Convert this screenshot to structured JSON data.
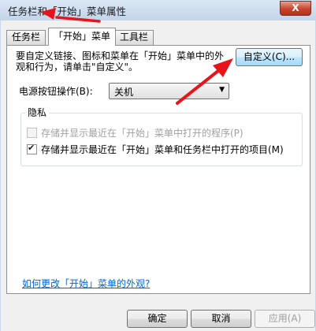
{
  "window": {
    "title": "任务栏和「开始」菜单属性",
    "close_label": "X"
  },
  "tabs": [
    {
      "label": "任务栏",
      "active": false
    },
    {
      "label": "「开始」菜单",
      "active": true
    },
    {
      "label": "工具栏",
      "active": false
    }
  ],
  "panel": {
    "description": "要自定义链接、图标和菜单在「开始」菜单中的外观和行为，请单击\"自定义\"。",
    "customize_button": "自定义(C)...",
    "power_label": "电源按钮操作(B):",
    "power_value": "关机",
    "privacy": {
      "title": "隐私",
      "option1": {
        "label": "存储并显示最近在「开始」菜单中打开的程序(P)",
        "checked": false,
        "enabled": false
      },
      "option2": {
        "label": "存储并显示最近在「开始」菜单和任务栏中打开的项目(M)",
        "checked": true,
        "enabled": true
      }
    },
    "help_link": "如何更改「开始」菜单的外观?"
  },
  "buttons": {
    "ok": "确定",
    "cancel": "取消",
    "apply": "应用(A)"
  },
  "annotation_color": "#e8141b",
  "icons": {
    "close": "close-icon",
    "checkmark": "checkmark-icon",
    "dropdown": "chevron-down-icon"
  }
}
